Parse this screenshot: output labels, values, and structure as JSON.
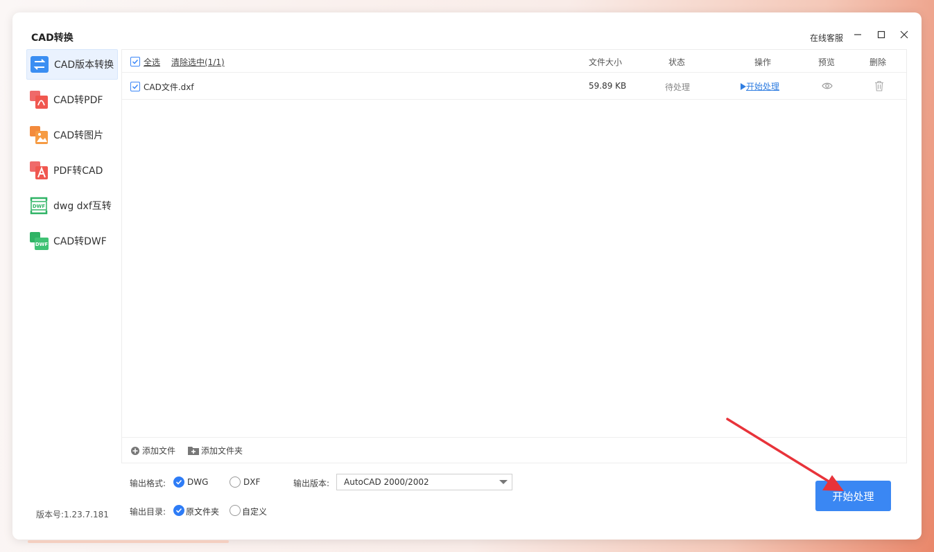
{
  "app": {
    "title": "CAD转换",
    "customer_service": "在线客服",
    "version": "版本号:1.23.7.181"
  },
  "sidebar": {
    "items": [
      {
        "label": "CAD版本转换",
        "active": true
      },
      {
        "label": "CAD转PDF",
        "active": false
      },
      {
        "label": "CAD转图片",
        "active": false
      },
      {
        "label": "PDF转CAD",
        "active": false
      },
      {
        "label": "dwg dxf互转",
        "active": false
      },
      {
        "label": "CAD转DWF",
        "active": false
      }
    ]
  },
  "table": {
    "select_all": "全选",
    "clear_selection": "清除选中(1/1)",
    "columns": {
      "size": "文件大小",
      "status": "状态",
      "action": "操作",
      "preview": "预览",
      "delete": "删除"
    },
    "rows": [
      {
        "name": "CAD文件.dxf",
        "size": "59.89 KB",
        "status": "待处理",
        "action": "开始处理",
        "checked": true
      }
    ]
  },
  "footer": {
    "add_file": "添加文件",
    "add_folder": "添加文件夹"
  },
  "options": {
    "format_label": "输出格式:",
    "format_options": [
      "DWG",
      "DXF"
    ],
    "format_selected": "DWG",
    "version_label": "输出版本:",
    "version_value": "AutoCAD 2000/2002",
    "dir_label": "输出目录:",
    "dir_options": [
      "原文件夹",
      "自定义"
    ],
    "dir_selected": "原文件夹"
  },
  "start_button": "开始处理",
  "colors": {
    "accent": "#3a87f3",
    "annotation_arrow": "#e8333a"
  }
}
